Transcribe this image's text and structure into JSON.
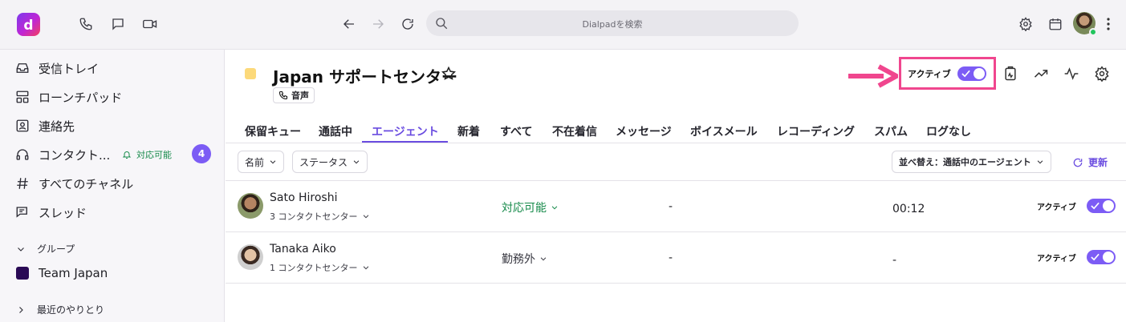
{
  "topbar": {
    "logo_letter": "d",
    "search_placeholder": "Dialpadを検索",
    "icons": [
      "phone-icon",
      "chat-icon",
      "video-icon",
      "back-icon",
      "forward-icon",
      "reload-icon",
      "search-icon",
      "settings-icon",
      "calendar-icon",
      "more-icon"
    ]
  },
  "sidebar": {
    "items": [
      {
        "label": "受信トレイ",
        "icon": "inbox-icon"
      },
      {
        "label": "ローンチパッド",
        "icon": "launchpad-icon"
      },
      {
        "label": "連絡先",
        "icon": "contacts-icon"
      },
      {
        "label": "コンタクト...",
        "icon": "headset-icon"
      },
      {
        "label": "すべてのチャネル",
        "icon": "hash-icon"
      },
      {
        "label": "スレッド",
        "icon": "thread-icon"
      }
    ],
    "availability": "対応可能",
    "badge_count": "4",
    "group_header": "グループ",
    "team_label": "Team Japan",
    "recent_header": "最近のやりとり",
    "team_color": "#2a0a55"
  },
  "header": {
    "title": "Japan サポートセンター",
    "tag": "音声",
    "active_label": "アクティブ",
    "highlight_color": "#f0468e",
    "accent_color": "#7c5cf5"
  },
  "tabs": [
    "保留キュー",
    "通話中",
    "エージェント",
    "新着",
    "すべて",
    "不在着信",
    "メッセージ",
    "ボイスメール",
    "レコーディング",
    "スパム",
    "ログなし"
  ],
  "active_tab": "エージェント",
  "filters": {
    "name": "名前",
    "status": "ステータス",
    "sort": "並べ替え：通話中のエージェント",
    "refresh": "更新"
  },
  "agents": [
    {
      "name": "Sato Hiroshi",
      "centers": "3 コンタクトセンター",
      "status": "対応可能",
      "status_color": "#168a4a",
      "col3": "-",
      "time": "00:12",
      "active_label": "アクティブ"
    },
    {
      "name": "Tanaka Aiko",
      "centers": "1 コンタクトセンター",
      "status": "勤務外",
      "status_color": "#3b3b44",
      "col3": "-",
      "time": "-",
      "active_label": "アクティブ"
    }
  ]
}
